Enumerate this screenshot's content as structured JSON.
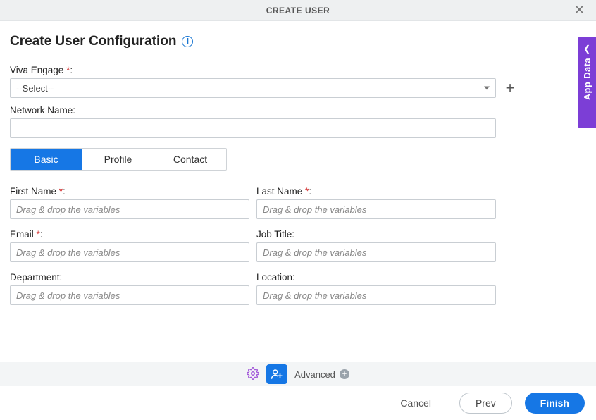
{
  "header": {
    "title": "CREATE USER"
  },
  "page": {
    "title": "Create User Configuration"
  },
  "sidepanel": {
    "label": "App Data"
  },
  "fields": {
    "viva_engage": {
      "label": "Viva Engage",
      "selected": "--Select--",
      "required": true
    },
    "network_name": {
      "label": "Network Name:",
      "value": ""
    }
  },
  "tabs": [
    {
      "id": "basic",
      "label": "Basic",
      "active": true
    },
    {
      "id": "profile",
      "label": "Profile",
      "active": false
    },
    {
      "id": "contact",
      "label": "Contact",
      "active": false
    }
  ],
  "basic": {
    "first_name": {
      "label": "First Name",
      "required": true,
      "placeholder": "Drag & drop the variables"
    },
    "last_name": {
      "label": "Last Name",
      "required": true,
      "placeholder": "Drag & drop the variables"
    },
    "email": {
      "label": "Email",
      "required": true,
      "placeholder": "Drag & drop the variables"
    },
    "job_title": {
      "label": "Job Title:",
      "required": false,
      "placeholder": "Drag & drop the variables"
    },
    "department": {
      "label": "Department:",
      "required": false,
      "placeholder": "Drag & drop the variables"
    },
    "location": {
      "label": "Location:",
      "required": false,
      "placeholder": "Drag & drop the variables"
    }
  },
  "toolbar": {
    "advanced": "Advanced"
  },
  "footer": {
    "cancel": "Cancel",
    "prev": "Prev",
    "finish": "Finish"
  }
}
